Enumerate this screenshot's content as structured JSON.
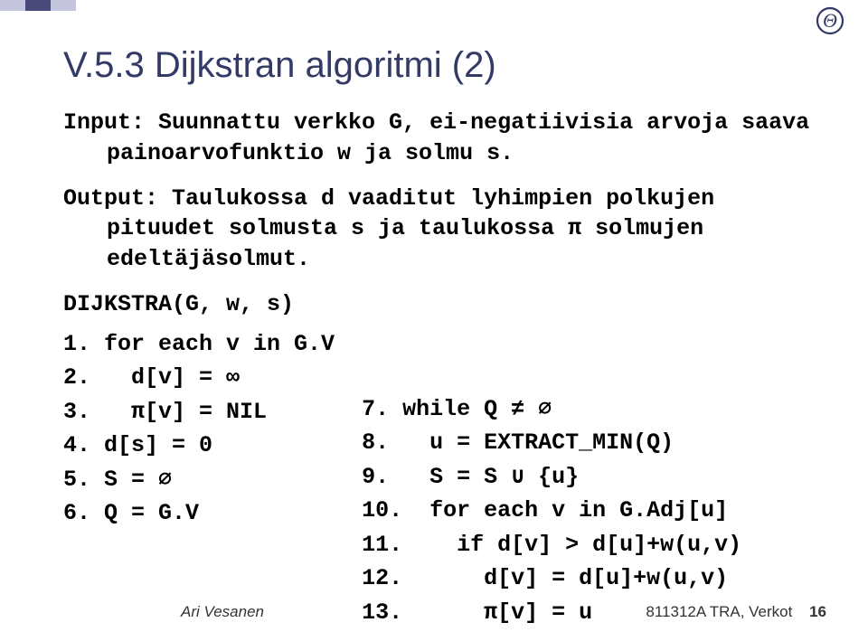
{
  "header": {
    "corner_glyph": "Θ"
  },
  "title": "V.5.3 Dijkstran algoritmi (2)",
  "io": {
    "input": "Input: Suunnattu verkko G, ei-negatiivisia arvoja saava painoarvofunktio w ja solmu s.",
    "output": "Output: Taulukossa d vaaditut lyhimpien polkujen pituudet solmusta s ja taulukossa π solmujen edeltäjäsolmut."
  },
  "algo": {
    "name": "DIJKSTRA(G, w, s)",
    "left": [
      "1. for each v in G.V",
      "2.   d[v] = ∞",
      "3.   π[v] = NIL",
      "4. d[s] = 0",
      "5. S = ∅",
      "6. Q = G.V"
    ],
    "right": [
      "7. while Q ≠ ∅",
      "8.   u = EXTRACT_MIN(Q)",
      "9.   S = S ∪ {u}",
      "10.  for each v in G.Adj[u]",
      "11.    if d[v] > d[u]+w(u,v)",
      "12.      d[v] = d[u]+w(u,v)",
      "13.      π[v] = u"
    ]
  },
  "footer": {
    "author": "Ari Vesanen",
    "course": "811312A TRA, Verkot",
    "page": "16"
  }
}
